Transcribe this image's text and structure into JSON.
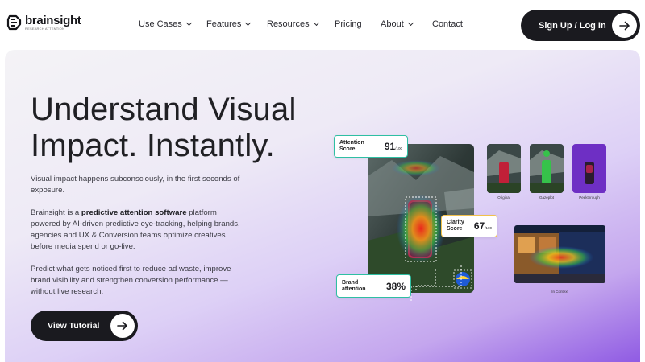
{
  "brand": {
    "name": "brainsight",
    "tagline": "RESEARCH ATTENTION"
  },
  "nav": {
    "items": [
      {
        "label": "Use Cases",
        "dropdown": true
      },
      {
        "label": "Features",
        "dropdown": true
      },
      {
        "label": "Resources",
        "dropdown": true
      },
      {
        "label": "Pricing",
        "dropdown": false
      },
      {
        "label": "About",
        "dropdown": true
      },
      {
        "label": "Contact",
        "dropdown": false
      }
    ],
    "cta": "Sign Up / Log In"
  },
  "hero": {
    "headline_line1": "Understand Visual",
    "headline_line2": "Impact. Instantly.",
    "p1": "Visual impact happens subconsciously, in the first seconds of exposure.",
    "p2_before": "Brainsight is a ",
    "p2_bold": "predictive attention software",
    "p2_after": " platform powered by AI-driven predictive eye-tracking, helping brands, agencies and UX & Conversion teams optimize creatives before media spend or go-live.",
    "p3": "Predict what gets noticed first to reduce ad waste, improve brand visibility and strengthen conversion performance — without live research.",
    "button": "View Tutorial"
  },
  "visual": {
    "attention": {
      "label_1": "Attention",
      "label_2": "Score",
      "value": "91",
      "suffix": "/100"
    },
    "clarity": {
      "label_1": "Clarity",
      "label_2": "Score",
      "value": "67",
      "suffix": "/100"
    },
    "brand_attention": {
      "label_1": "Brand",
      "label_2": "attention",
      "value": "38%"
    },
    "thumbnails": [
      "Original",
      "Gazeplot",
      "Peekthrough"
    ],
    "context_caption": "In Context"
  },
  "colors": {
    "dark": "#1a1a1f",
    "attention_border": "#2fbfa3",
    "clarity_border": "#f2c14b",
    "brand_border": "#2fbfa3",
    "accent_purple": "#8f5ae3"
  }
}
